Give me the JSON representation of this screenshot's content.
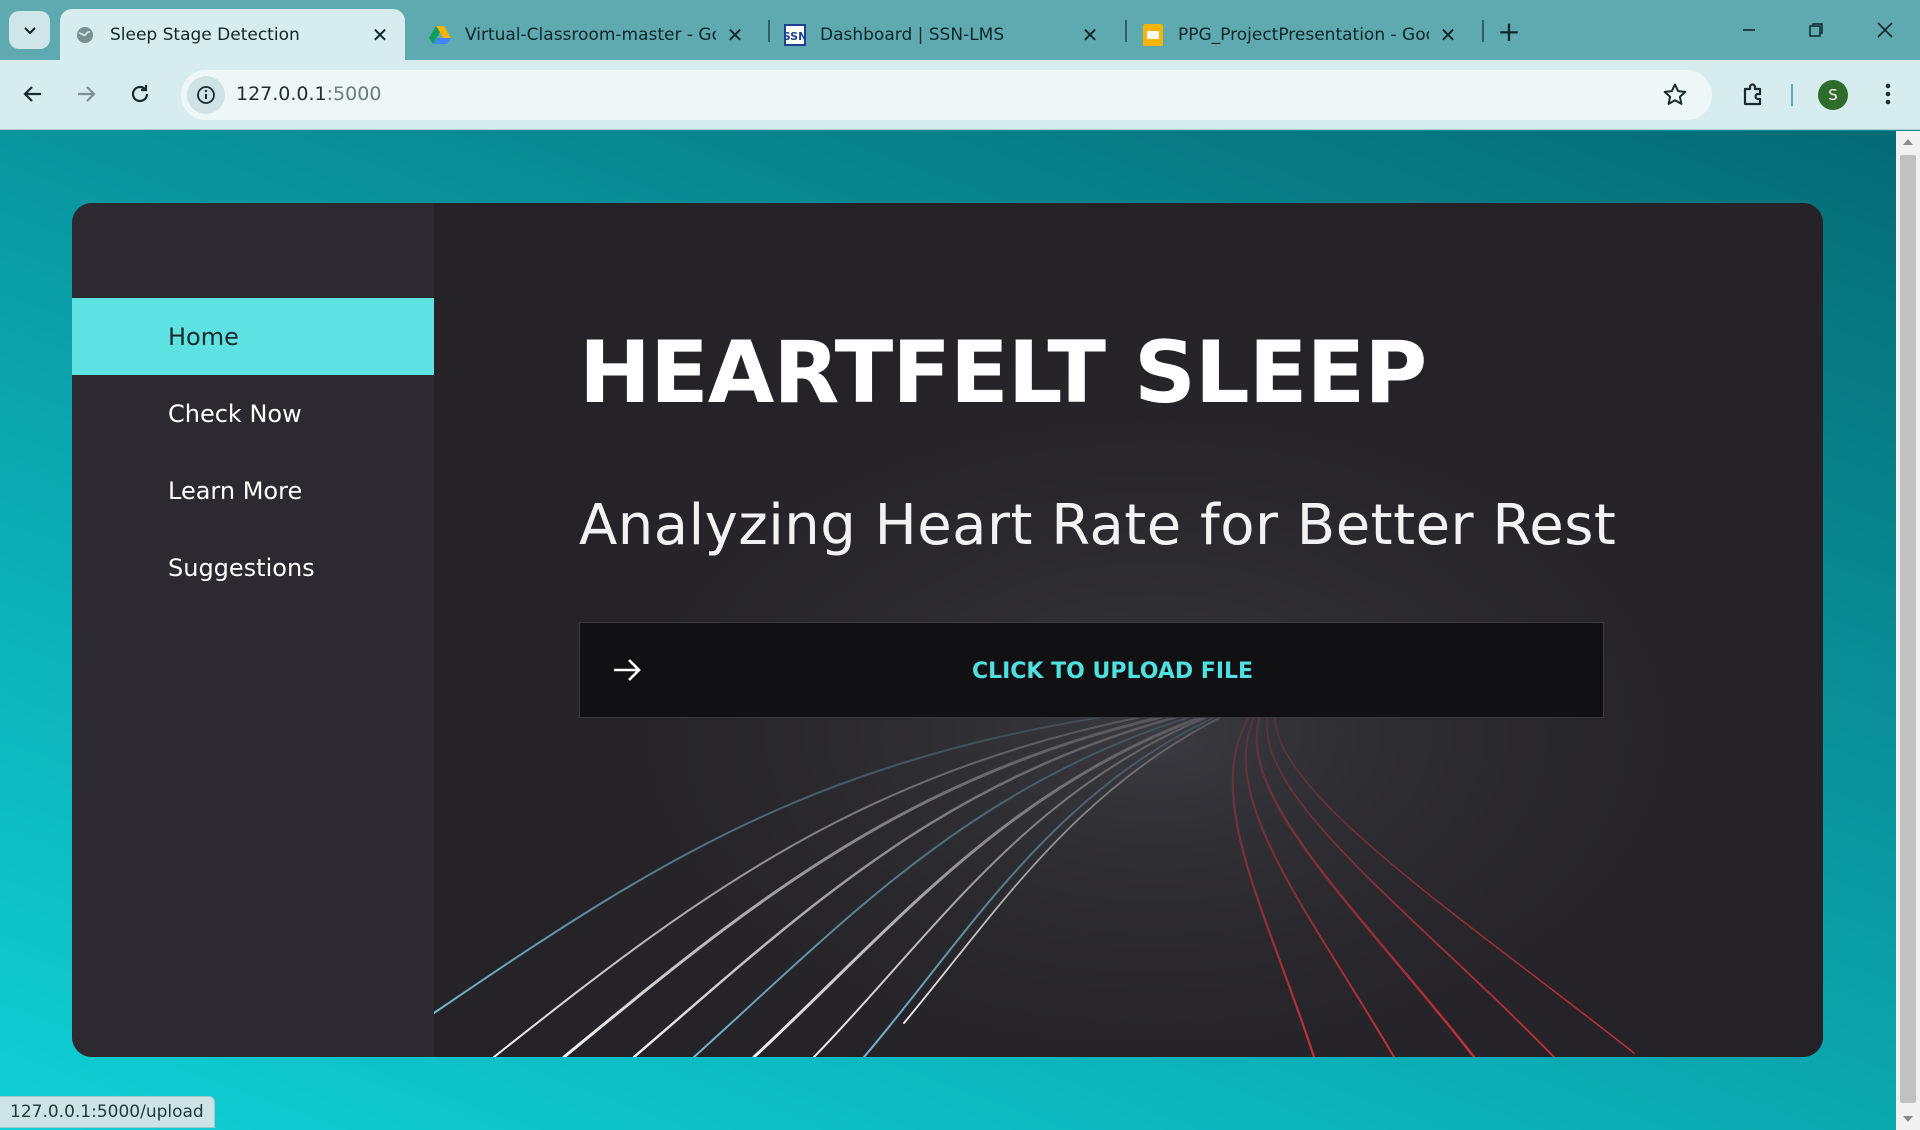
{
  "browser": {
    "tabs": [
      {
        "title": "Sleep Stage Detection",
        "active": true,
        "favicon": "globe-icon"
      },
      {
        "title": "Virtual-Classroom-master - Goo",
        "active": false,
        "favicon": "google-drive-icon"
      },
      {
        "title": "Dashboard | SSN-LMS",
        "active": false,
        "favicon": "ssn-logo-icon"
      },
      {
        "title": "PPG_ProjectPresentation - Goo",
        "active": false,
        "favicon": "google-slides-icon"
      }
    ],
    "url_host": "127.0.0.1",
    "url_port": ":5000",
    "profile_initial": "S",
    "status_url": "127.0.0.1:5000/upload"
  },
  "sidebar": {
    "items": [
      {
        "label": "Home",
        "active": true
      },
      {
        "label": "Check Now",
        "active": false
      },
      {
        "label": "Learn More",
        "active": false
      },
      {
        "label": "Suggestions",
        "active": false
      }
    ]
  },
  "hero": {
    "title": "HEARTFELT SLEEP",
    "subtitle": "Analyzing Heart Rate for Better Rest",
    "upload_label": "CLICK TO UPLOAD FILE"
  },
  "colors": {
    "accent": "#5ee2e2",
    "upload_text": "#4fe0e0",
    "card_bg": "#262428",
    "sidebar_bg": "#2c2a30",
    "page_bg": "#0b8f96"
  }
}
